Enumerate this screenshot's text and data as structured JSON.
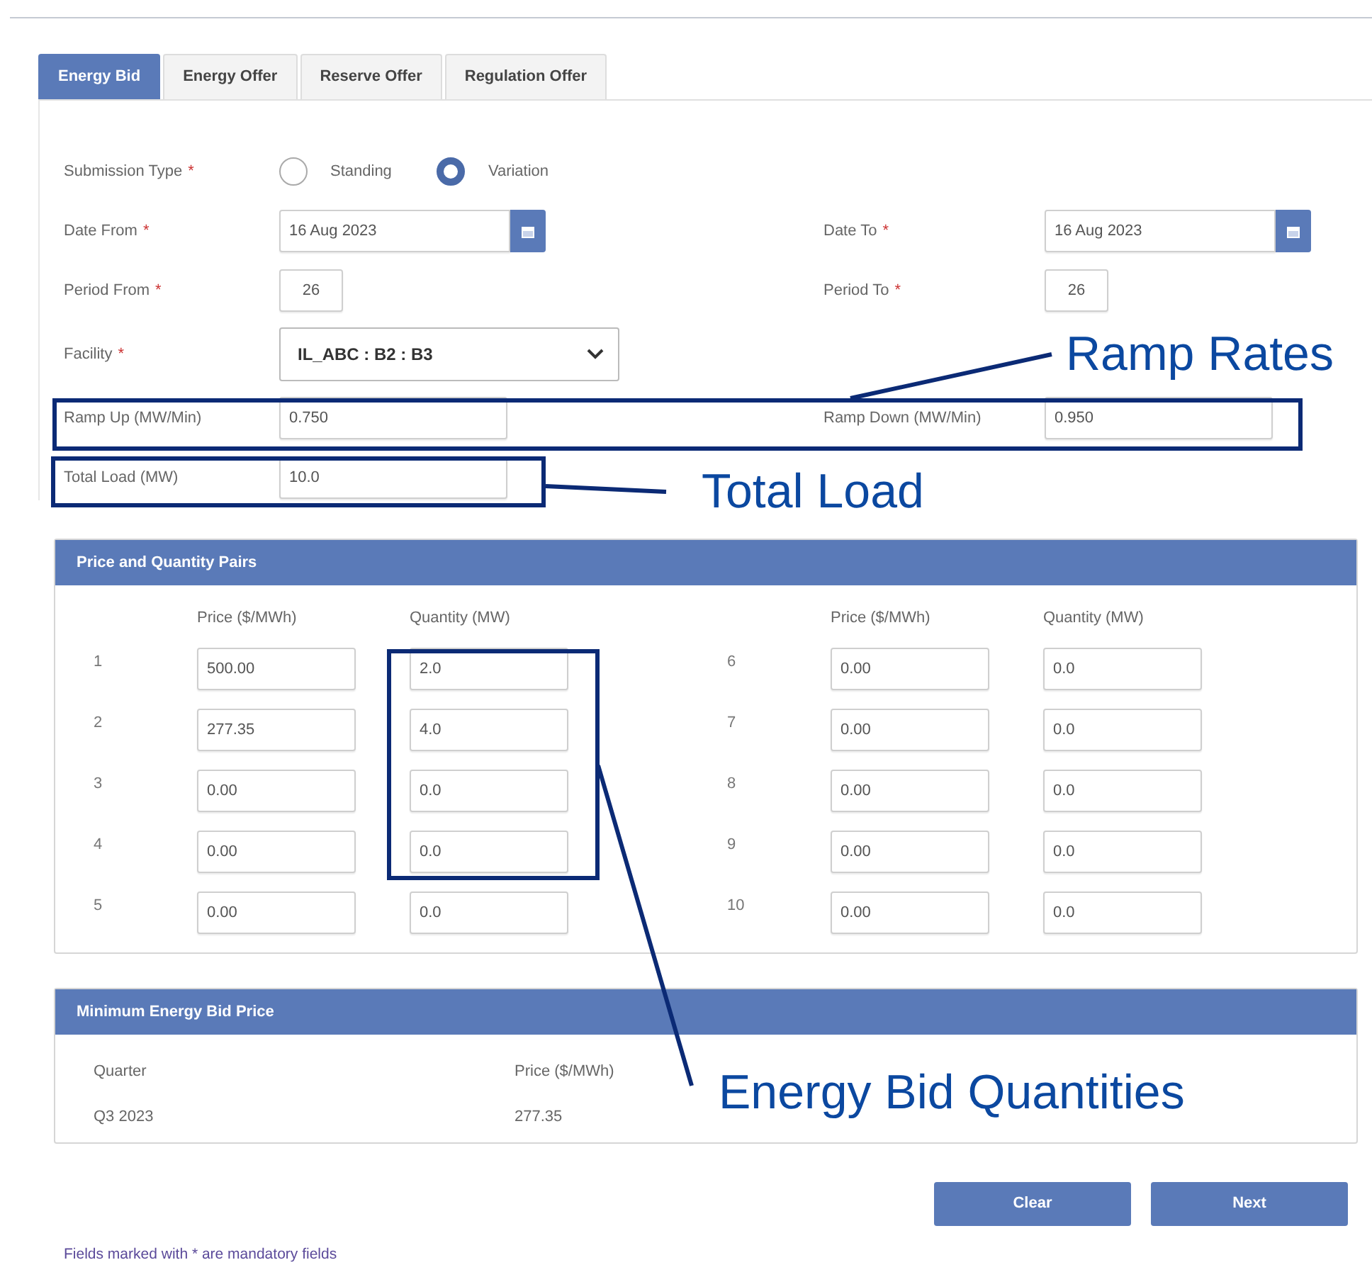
{
  "tabs": [
    {
      "label": "Energy Bid",
      "selected": true
    },
    {
      "label": "Energy Offer",
      "selected": false
    },
    {
      "label": "Reserve Offer",
      "selected": false
    },
    {
      "label": "Regulation Offer",
      "selected": false
    }
  ],
  "form_rows": [
    {
      "left": {
        "kind": "radio",
        "label": "Submission Type",
        "required_mark": "*",
        "options": [
          {
            "label": "Standing",
            "selected": false
          },
          {
            "label": "Variation",
            "selected": true
          }
        ]
      }
    },
    {
      "left": {
        "kind": "date",
        "label": "Date From",
        "required_mark": "*",
        "value": "16 Aug 2023"
      },
      "right": {
        "kind": "date",
        "label": "Date To",
        "required_mark": "*",
        "value": "16 Aug 2023"
      }
    },
    {
      "left": {
        "kind": "short",
        "label": "Period From",
        "required_mark": "*",
        "value": "26"
      },
      "right": {
        "kind": "short",
        "label": "Period To",
        "required_mark": "*",
        "value": "26"
      }
    },
    {
      "left": {
        "kind": "select",
        "label": "Facility",
        "required_mark": "*",
        "value": "IL_ABC : B2 : B3"
      }
    },
    {
      "left": {
        "kind": "text",
        "label": "Ramp Up (MW/Min)",
        "value": "0.750"
      },
      "right": {
        "kind": "text",
        "label": "Ramp Down (MW/Min)",
        "value": "0.950"
      }
    },
    {
      "left": {
        "kind": "text",
        "label": "Total Load (MW)",
        "value": "10.0"
      }
    }
  ],
  "pairs_panel": {
    "title": "Price and Quantity Pairs",
    "columns": [
      "Price ($/MWh)",
      "Quantity (MW)",
      "Price ($/MWh)",
      "Quantity (MW)"
    ],
    "rows": [
      {
        "number": "1",
        "price": "500.00",
        "quantity": "2.0"
      },
      {
        "number": "2",
        "price": "277.35",
        "quantity": "4.0"
      },
      {
        "number": "3",
        "price": "0.00",
        "quantity": "0.0"
      },
      {
        "number": "4",
        "price": "0.00",
        "quantity": "0.0"
      },
      {
        "number": "5",
        "price": "0.00",
        "quantity": "0.0"
      },
      {
        "number": "6",
        "price": "0.00",
        "quantity": "0.0"
      },
      {
        "number": "7",
        "price": "0.00",
        "quantity": "0.0"
      },
      {
        "number": "8",
        "price": "0.00",
        "quantity": "0.0"
      },
      {
        "number": "9",
        "price": "0.00",
        "quantity": "0.0"
      },
      {
        "number": "10",
        "price": "0.00",
        "quantity": "0.0"
      }
    ]
  },
  "min_price_panel": {
    "title": "Minimum Energy Bid Price",
    "columns": [
      "Quarter",
      "Price ($/MWh)"
    ],
    "rows": [
      [
        "Q3 2023",
        "277.35"
      ]
    ]
  },
  "buttons": [
    {
      "label": "Clear"
    },
    {
      "label": "Next"
    }
  ],
  "footnote": "Fields marked with * are mandatory fields",
  "annotations": [
    {
      "label": "Ramp Rates"
    },
    {
      "label": "Total Load"
    },
    {
      "label": "Energy Bid Quantities"
    }
  ]
}
